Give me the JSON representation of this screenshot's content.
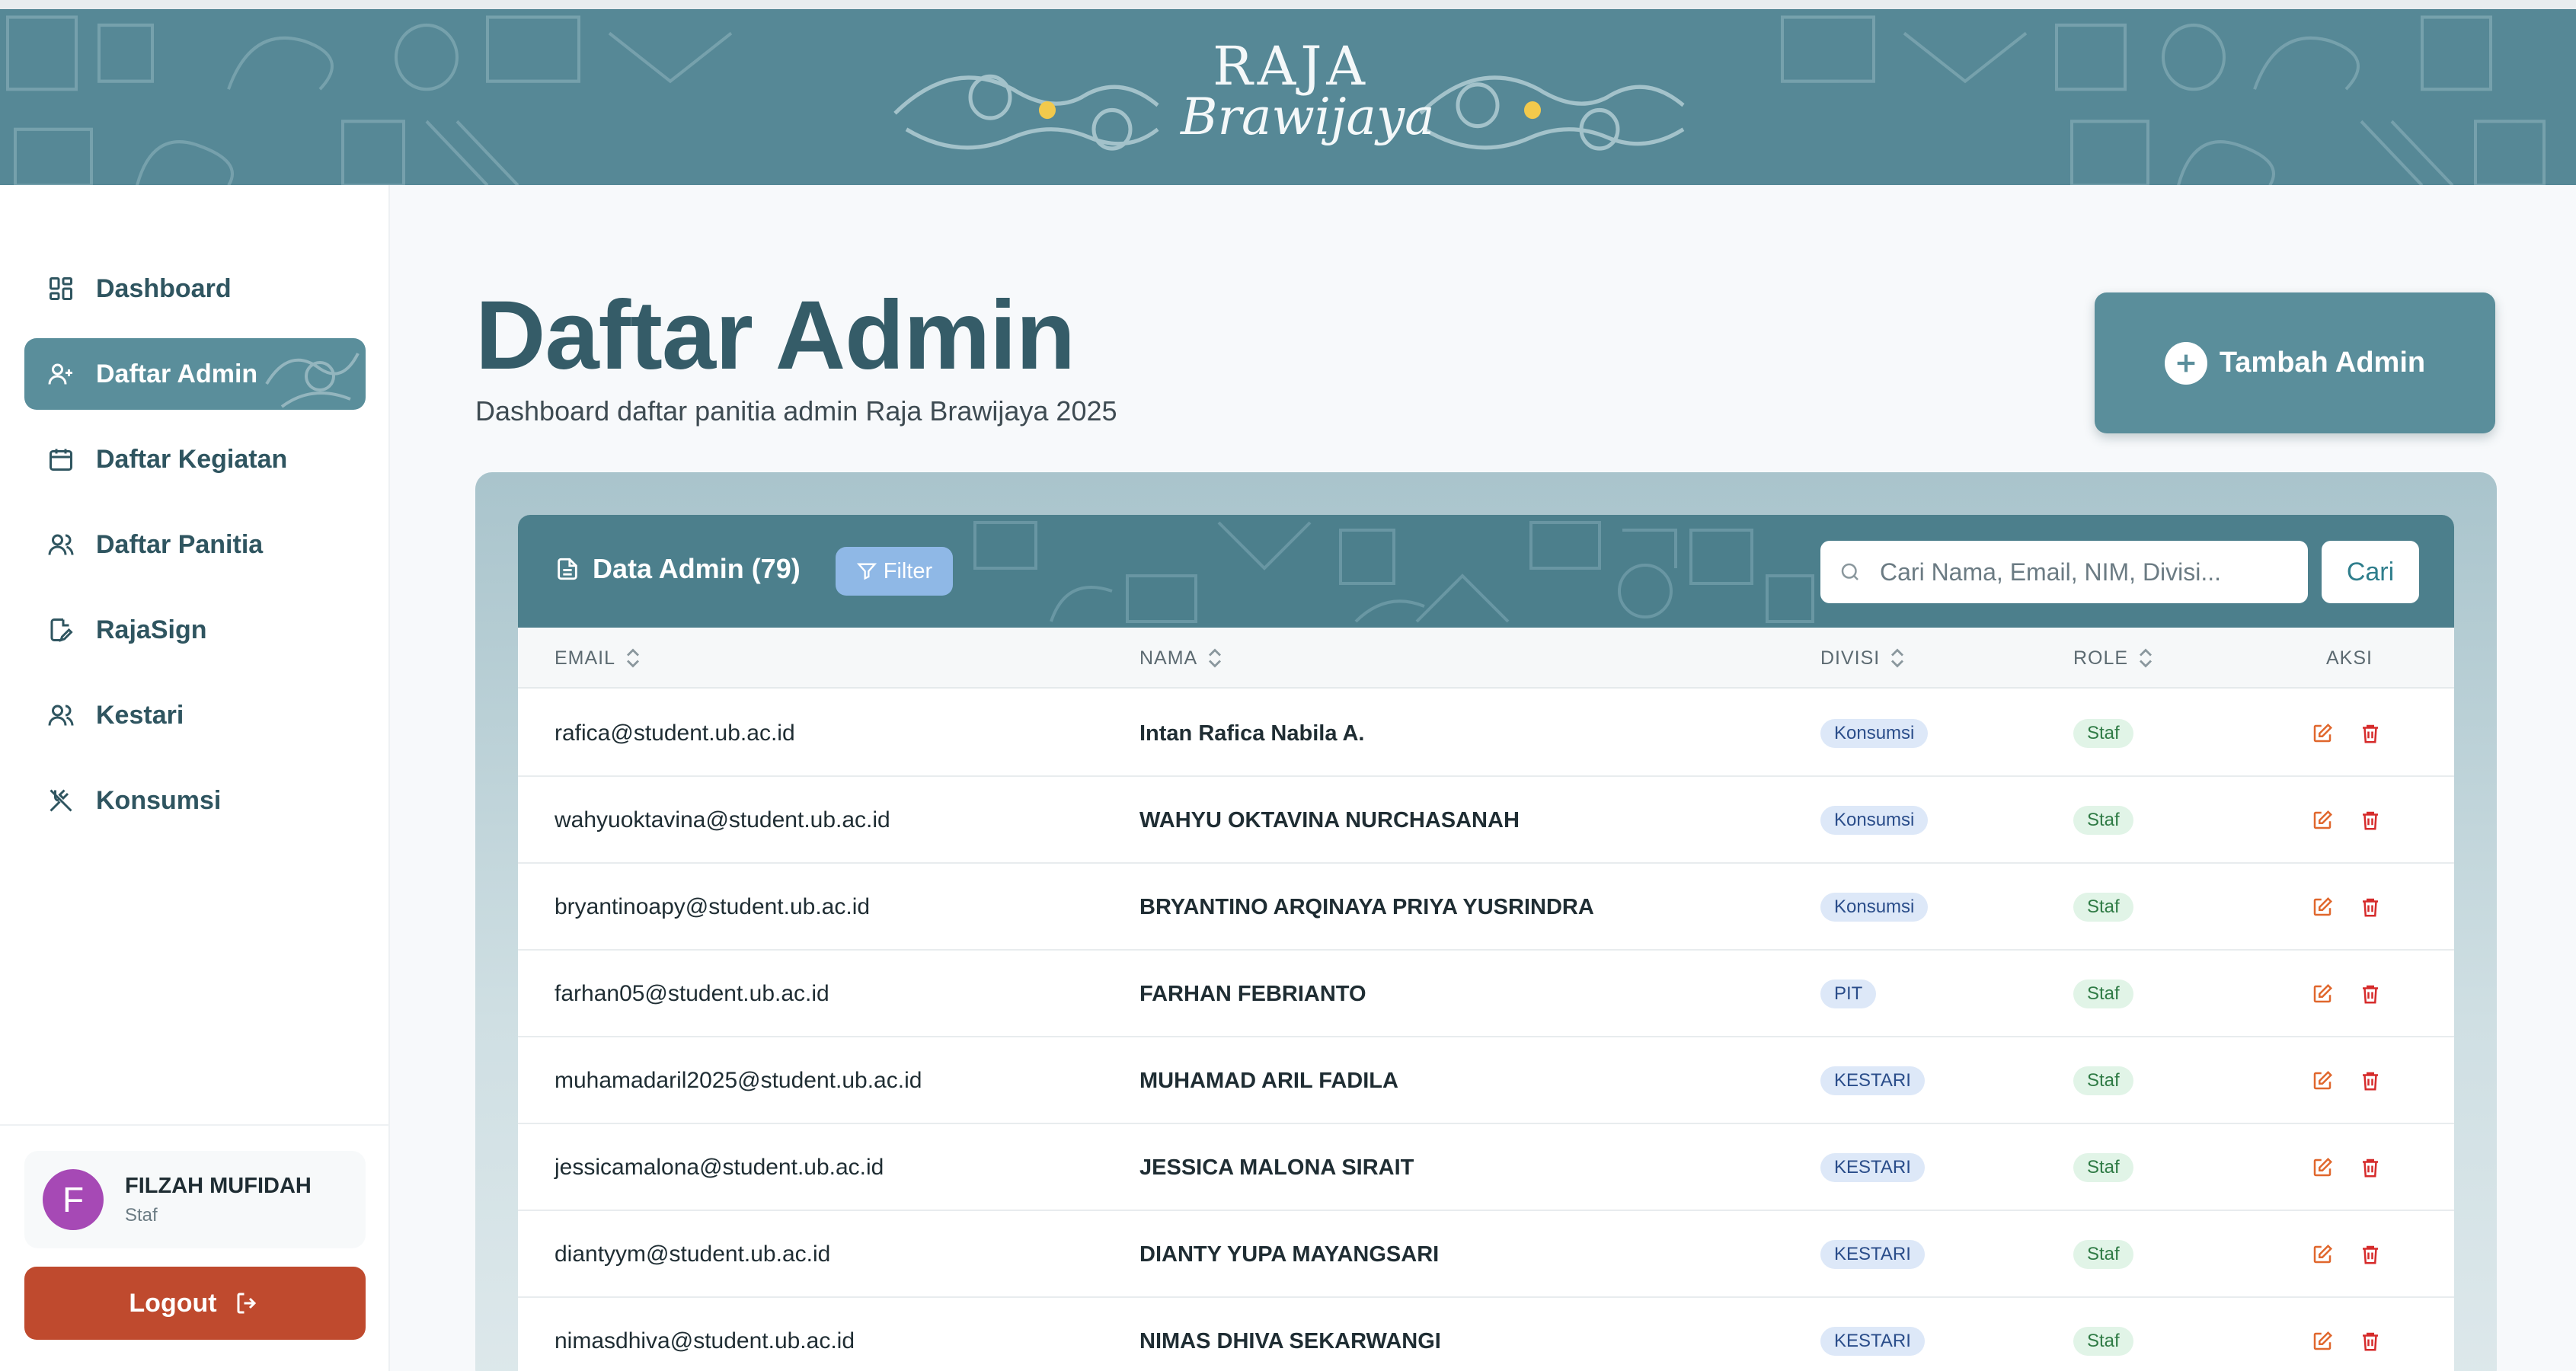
{
  "brand": {
    "line1": "RAJA",
    "line2": "Brawijaya"
  },
  "sidebar": {
    "items": [
      {
        "label": "Dashboard",
        "icon": "dashboard-grid-icon"
      },
      {
        "label": "Daftar Admin",
        "icon": "user-plus-icon"
      },
      {
        "label": "Daftar Kegiatan",
        "icon": "calendar-icon"
      },
      {
        "label": "Daftar Panitia",
        "icon": "users-icon"
      },
      {
        "label": "RajaSign",
        "icon": "signature-document-icon"
      },
      {
        "label": "Kestari",
        "icon": "users-icon"
      },
      {
        "label": "Konsumsi",
        "icon": "utensils-icon"
      }
    ],
    "user": {
      "initial": "F",
      "name": "FILZAH MUFIDAH",
      "role": "Staf"
    },
    "logout_label": "Logout"
  },
  "main": {
    "title": "Daftar Admin",
    "subtitle": "Dashboard daftar panitia admin Raja Brawijaya 2025",
    "add_button_label": "Tambah Admin"
  },
  "table": {
    "title": "Data Admin (79)",
    "filter_label": "Filter",
    "search_placeholder": "Cari Nama, Email, NIM, Divisi...",
    "search_button_label": "Cari",
    "columns": [
      "EMAIL",
      "NAMA",
      "DIVISI",
      "ROLE",
      "AKSI"
    ],
    "rows": [
      {
        "email": "rafica@student.ub.ac.id",
        "nama": "Intan Rafica Nabila A.",
        "divisi": "Konsumsi",
        "role": "Staf"
      },
      {
        "email": "wahyuoktavina@student.ub.ac.id",
        "nama": "WAHYU OKTAVINA NURCHASANAH",
        "divisi": "Konsumsi",
        "role": "Staf"
      },
      {
        "email": "bryantinoapy@student.ub.ac.id",
        "nama": "BRYANTINO ARQINAYA PRIYA YUSRINDRA",
        "divisi": "Konsumsi",
        "role": "Staf"
      },
      {
        "email": "farhan05@student.ub.ac.id",
        "nama": "FARHAN FEBRIANTO",
        "divisi": "PIT",
        "role": "Staf"
      },
      {
        "email": "muhamadaril2025@student.ub.ac.id",
        "nama": "MUHAMAD ARIL FADILA",
        "divisi": "KESTARI",
        "role": "Staf"
      },
      {
        "email": "jessicamalona@student.ub.ac.id",
        "nama": "JESSICA MALONA SIRAIT",
        "divisi": "KESTARI",
        "role": "Staf"
      },
      {
        "email": "diantyym@student.ub.ac.id",
        "nama": "DIANTY YUPA MAYANGSARI",
        "divisi": "KESTARI",
        "role": "Staf"
      },
      {
        "email": "nimasdhiva@student.ub.ac.id",
        "nama": "NIMAS DHIVA SEKARWANGI",
        "divisi": "KESTARI",
        "role": "Staf"
      }
    ]
  },
  "colors": {
    "banner": "#568896",
    "primary": "#5a8e9b",
    "logout": "#bf4a2e",
    "edit_icon": "#e0672d",
    "delete_icon": "#d62b2b"
  }
}
